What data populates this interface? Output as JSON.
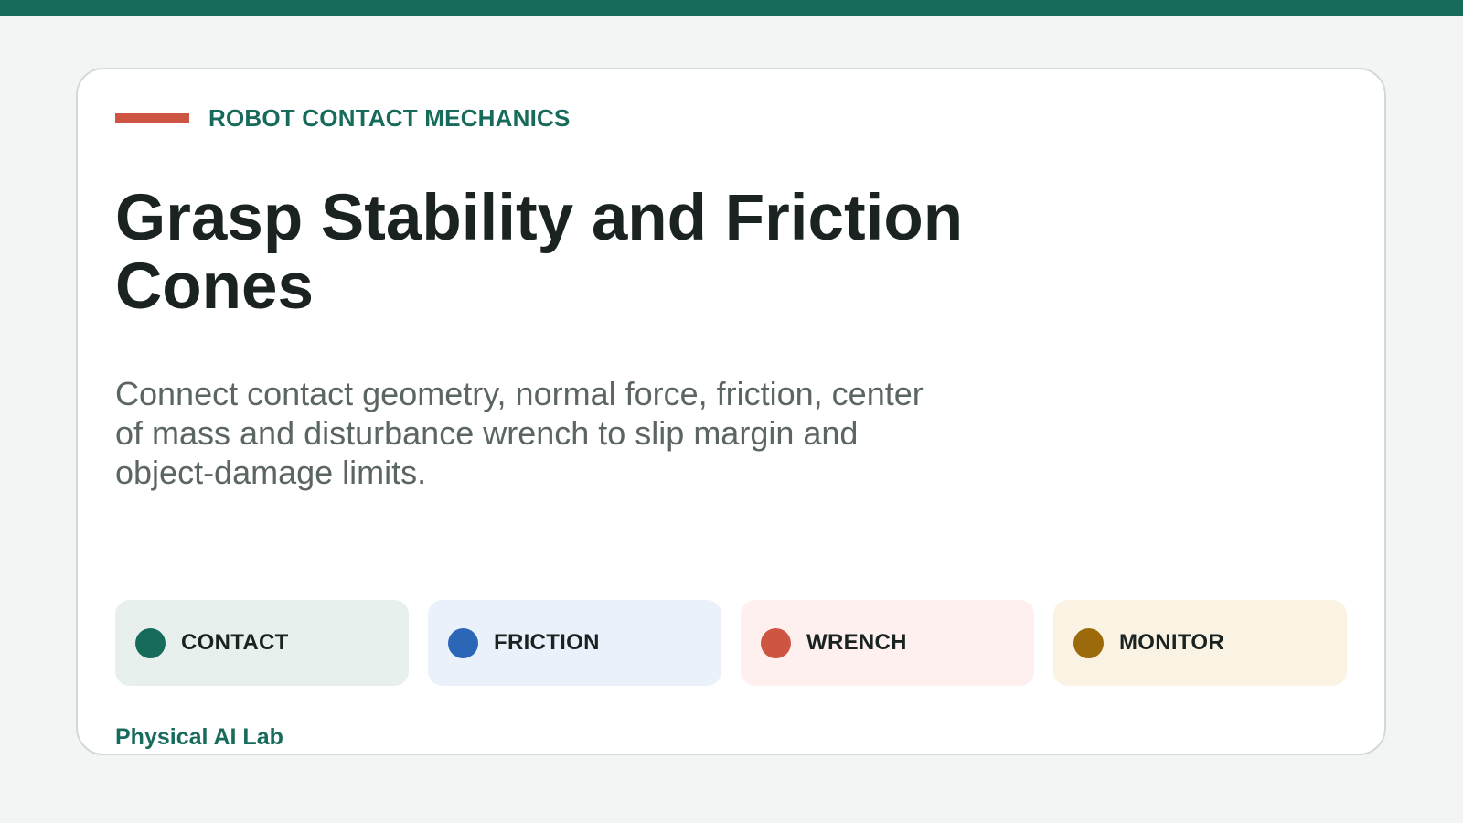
{
  "header": {
    "eyebrow": "ROBOT CONTACT MECHANICS",
    "title": "Grasp Stability and Friction Cones",
    "subtitle": "Connect contact geometry, normal force, friction, center of mass and disturbance wrench to slip margin and object-damage limits."
  },
  "chips": [
    {
      "label": "CONTACT",
      "icon": "dot-icon",
      "dot_color": "#176b5b",
      "bg_color": "#e8f0ee"
    },
    {
      "label": "FRICTION",
      "icon": "dot-icon",
      "dot_color": "#2b67b6",
      "bg_color": "#eaf1fa"
    },
    {
      "label": "WRENCH",
      "icon": "dot-icon",
      "dot_color": "#cf5543",
      "bg_color": "#fdf0ee"
    },
    {
      "label": "MONITOR",
      "icon": "dot-icon",
      "dot_color": "#9c6a0b",
      "bg_color": "#faf3e3"
    }
  ],
  "footer": {
    "lab": "Physical AI Lab"
  },
  "colors": {
    "accent": "#176b5b",
    "eyebrow_bar": "#cf5543",
    "background": "#f3f5f4"
  }
}
